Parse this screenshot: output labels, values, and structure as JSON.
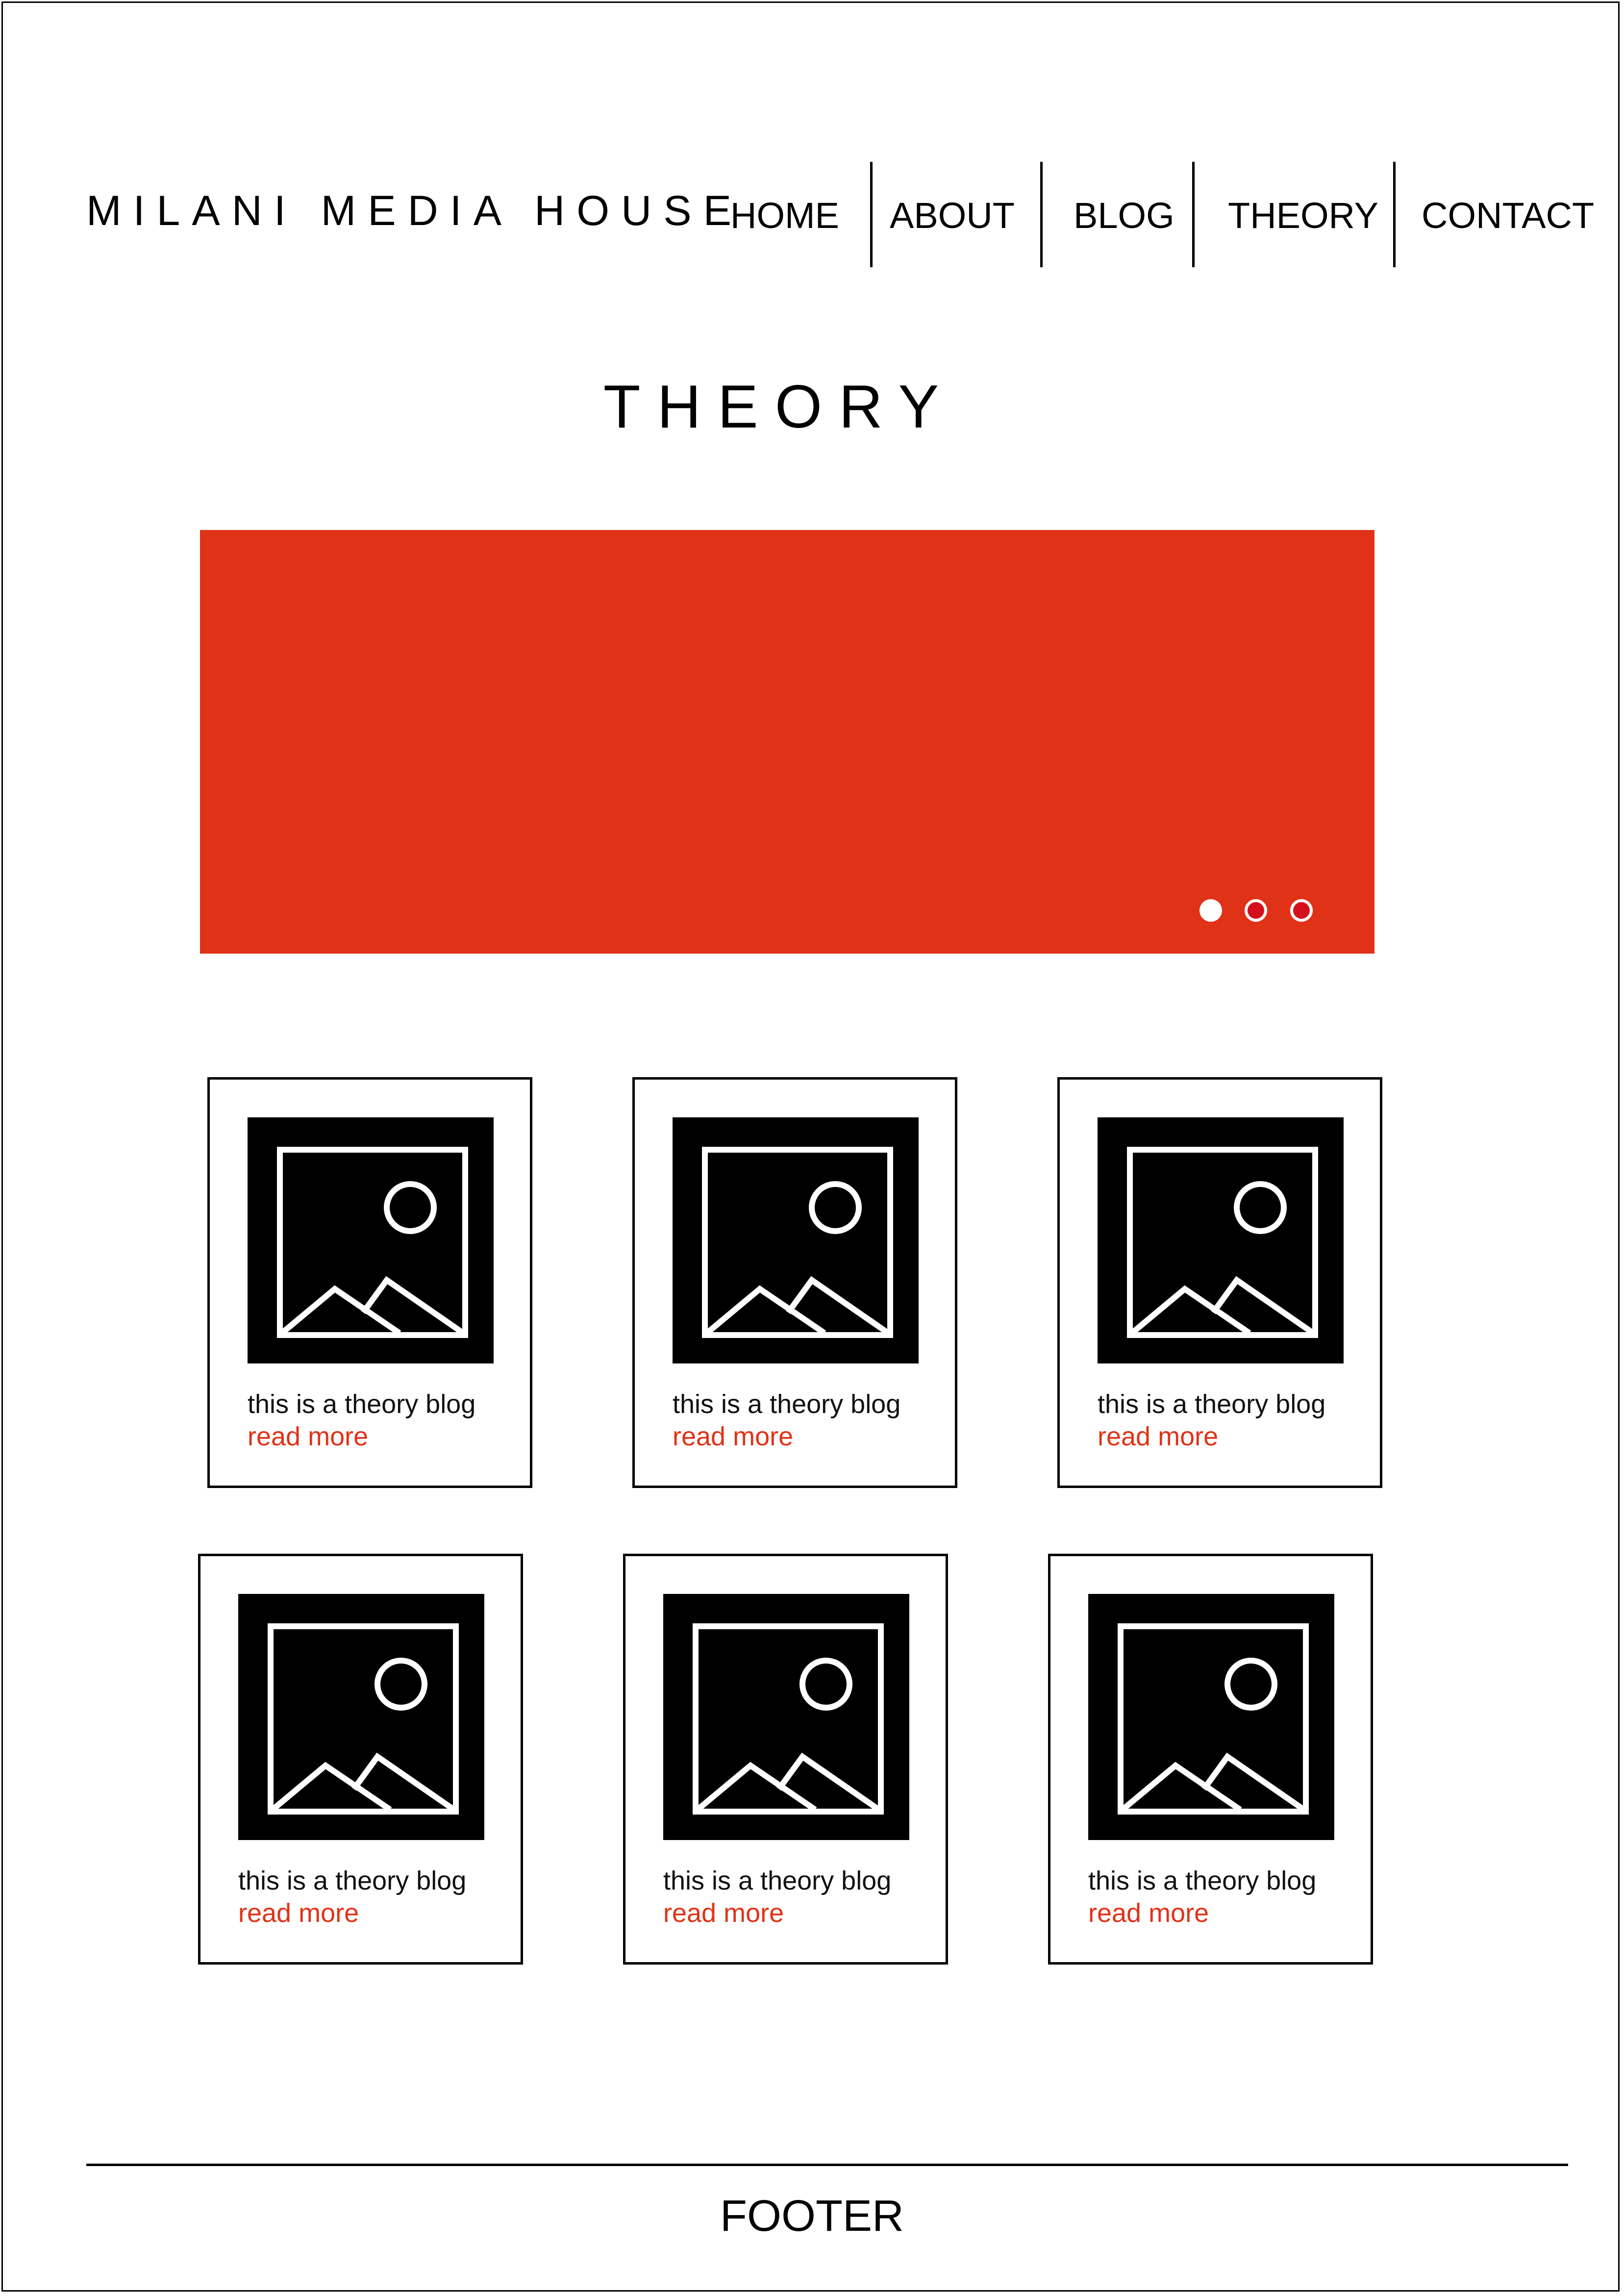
{
  "header": {
    "logo_text": "MILANI MEDIA HOUSE",
    "nav": [
      "HOME",
      "ABOUT",
      "BLOG",
      "THEORY",
      "CONTACT"
    ]
  },
  "page": {
    "title": "THEORY"
  },
  "hero": {
    "color": "#e03217",
    "slide_count": 3,
    "active_slide": 1
  },
  "posts": [
    {
      "title": "this is a theory blog",
      "link": "read more",
      "icon": "image-placeholder-icon"
    },
    {
      "title": "this is a theory blog",
      "link": "read more",
      "icon": "image-placeholder-icon"
    },
    {
      "title": "this is a theory blog",
      "link": "read more",
      "icon": "image-placeholder-icon"
    },
    {
      "title": "this is a theory blog",
      "link": "read more",
      "icon": "image-placeholder-icon"
    },
    {
      "title": "this is a theory blog",
      "link": "read more",
      "icon": "image-placeholder-icon"
    },
    {
      "title": "this is a theory blog",
      "link": "read more",
      "icon": "image-placeholder-icon"
    }
  ],
  "footer": {
    "label": "FOOTER"
  },
  "colors": {
    "accent": "#e03217",
    "text": "#000000",
    "background": "#ffffff"
  }
}
